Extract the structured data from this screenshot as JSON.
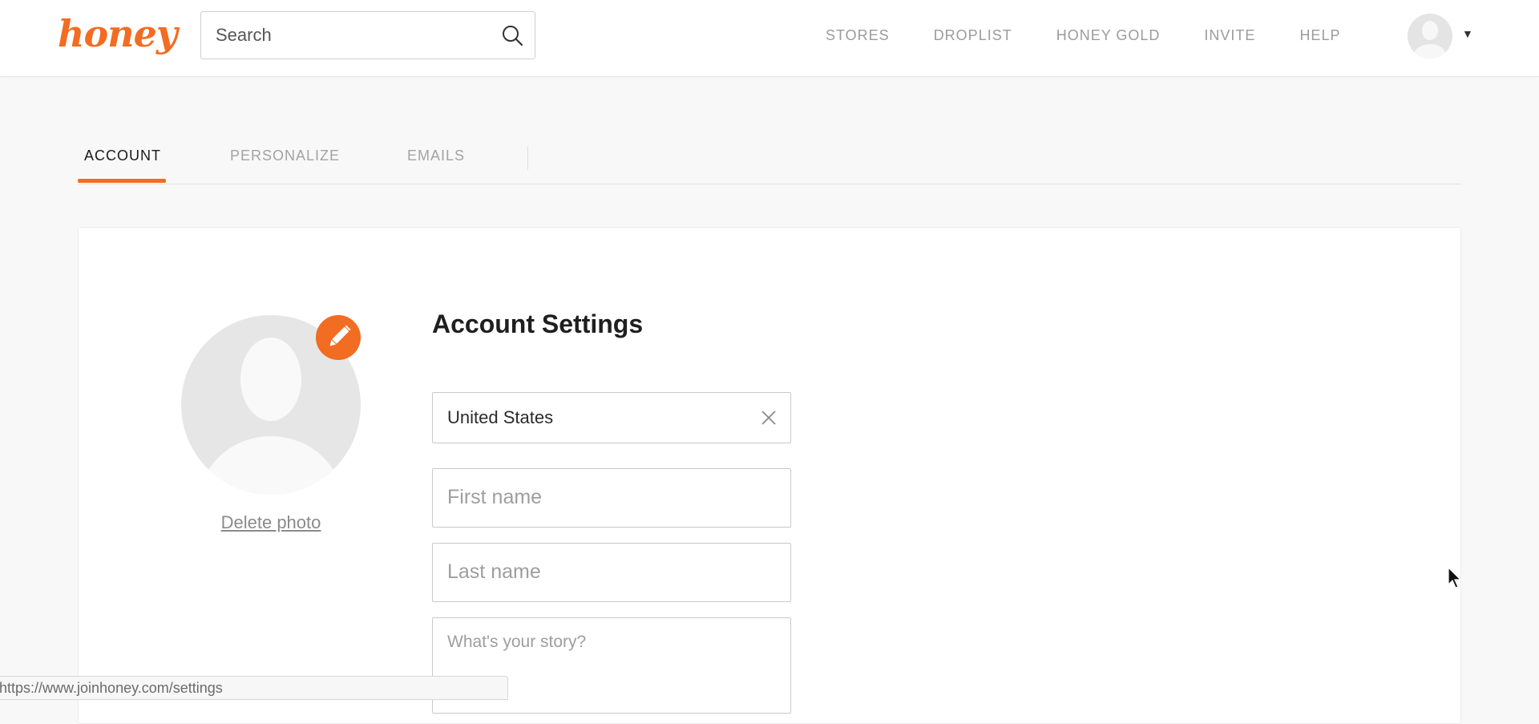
{
  "header": {
    "logo_text": "honey",
    "search": {
      "placeholder": "Search",
      "value": ""
    },
    "nav": [
      "STORES",
      "DROPLIST",
      "HONEY GOLD",
      "INVITE",
      "HELP"
    ],
    "user_menu": {
      "avatar_icon": "user-avatar-icon",
      "caret_icon": "caret-down-icon"
    }
  },
  "tabs": [
    {
      "label": "ACCOUNT",
      "active": true
    },
    {
      "label": "PERSONALIZE",
      "active": false
    },
    {
      "label": "EMAILS",
      "active": false
    }
  ],
  "account": {
    "title": "Account Settings",
    "photo": {
      "edit_icon": "pencil-icon",
      "delete_label": "Delete photo"
    },
    "fields": {
      "country": {
        "value": "United States",
        "clear_icon": "close-icon"
      },
      "first_name": {
        "placeholder": "First name",
        "value": ""
      },
      "last_name": {
        "placeholder": "Last name",
        "value": ""
      },
      "story": {
        "placeholder": "What's your story?",
        "value": ""
      }
    }
  },
  "status_bar": {
    "url": "https://www.joinhoney.com/settings"
  },
  "colors": {
    "brand": "#f26c22",
    "nav_text": "#9b9b9b",
    "background": "#f8f8f8",
    "card": "#ffffff"
  }
}
